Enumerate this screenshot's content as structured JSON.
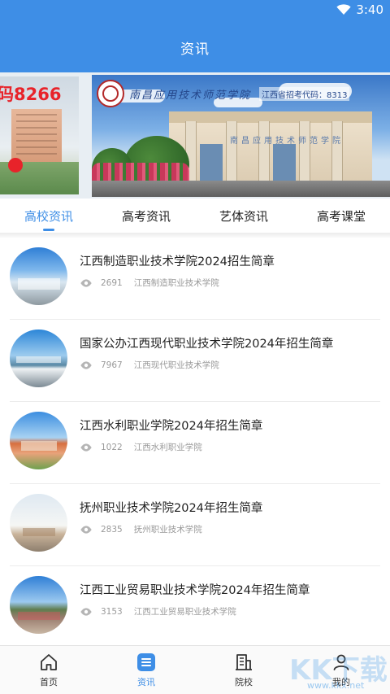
{
  "status_bar": {
    "time": "3:40"
  },
  "header": {
    "title": "资讯"
  },
  "banner": {
    "left_ad_text": "码8266",
    "main_caption": "南昌应用技术师范学院",
    "main_code": "江西省招考代码：8313"
  },
  "tabs": [
    {
      "label": "高校资讯",
      "active": true
    },
    {
      "label": "高考资讯",
      "active": false
    },
    {
      "label": "艺体资讯",
      "active": false
    },
    {
      "label": "高考课堂",
      "active": false
    }
  ],
  "news": [
    {
      "title": "江西制造职业技术学院2024招生简章",
      "views": "2691",
      "source": "江西制造职业技术学院"
    },
    {
      "title": "国家公办江西现代职业技术学院2024年招生简章",
      "views": "7967",
      "source": "江西现代职业技术学院"
    },
    {
      "title": "江西水利职业学院2024年招生简章",
      "views": "1022",
      "source": "江西水利职业学院"
    },
    {
      "title": "抚州职业技术学院2024年招生简章",
      "views": "2835",
      "source": "抚州职业技术学院"
    },
    {
      "title": "江西工业贸易职业技术学院2024年招生简章",
      "views": "3153",
      "source": "江西工业贸易职业技术学院"
    }
  ],
  "bottom_nav": [
    {
      "label": "首页",
      "icon": "home-icon"
    },
    {
      "label": "资讯",
      "icon": "news-icon",
      "active": true
    },
    {
      "label": "院校",
      "icon": "school-icon"
    },
    {
      "label": "我的",
      "icon": "user-icon"
    }
  ],
  "watermark": {
    "big": "KK下载",
    "small": "www.kkx.net"
  },
  "colors": {
    "accent": "#3e8ee6",
    "text": "#222222",
    "muted": "#9a9a9a"
  }
}
